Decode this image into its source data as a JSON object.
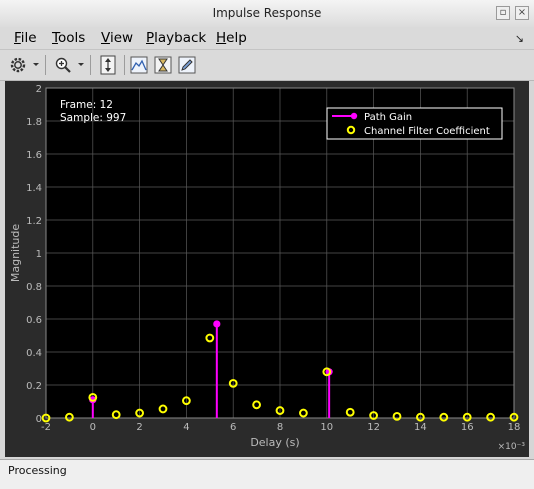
{
  "window": {
    "title": "Impulse Response"
  },
  "menu": {
    "items": [
      "File",
      "Tools",
      "View",
      "Playback",
      "Help"
    ]
  },
  "toolbar": {
    "icons": [
      "settings-gear-icon",
      "zoom-in-icon",
      "scale-axes-icon",
      "stem-plot-icon",
      "hourglass-icon",
      "edit-icon"
    ]
  },
  "chart_data": {
    "type": "stem",
    "xlabel": "Delay (s)",
    "ylabel": "Magnitude",
    "x_exponent": "×10⁻³",
    "xlim": [
      -2,
      18
    ],
    "ylim": [
      0,
      2
    ],
    "x_ticks": [
      -2,
      0,
      2,
      4,
      6,
      8,
      10,
      12,
      14,
      16,
      18
    ],
    "y_ticks": [
      0,
      0.2,
      0.4,
      0.6,
      0.8,
      1,
      1.2,
      1.4,
      1.6,
      1.8,
      2
    ],
    "grid": true,
    "legend_position": "top-right",
    "info": {
      "frame": "Frame: 12",
      "sample": "Sample: 997"
    },
    "series": [
      {
        "name": "Path Gain",
        "color": "#ff00ff",
        "marker": "filled-circle-stem",
        "x": [
          0,
          5.3,
          10.1
        ],
        "y": [
          0.11,
          0.57,
          0.28
        ]
      },
      {
        "name": "Channel Filter Coefficient",
        "color": "#ffff00",
        "marker": "hollow-circle",
        "x": [
          -2,
          -1,
          0,
          1,
          2,
          3,
          4,
          5,
          6,
          7,
          8,
          9,
          10,
          11,
          12,
          13,
          14,
          15,
          16,
          17,
          18
        ],
        "y": [
          0.0,
          0.005,
          0.125,
          0.02,
          0.03,
          0.055,
          0.105,
          0.485,
          0.21,
          0.08,
          0.045,
          0.03,
          0.28,
          0.035,
          0.015,
          0.01,
          0.005,
          0.005,
          0.005,
          0.005,
          0.005
        ]
      }
    ]
  },
  "status": {
    "text": "Processing"
  }
}
